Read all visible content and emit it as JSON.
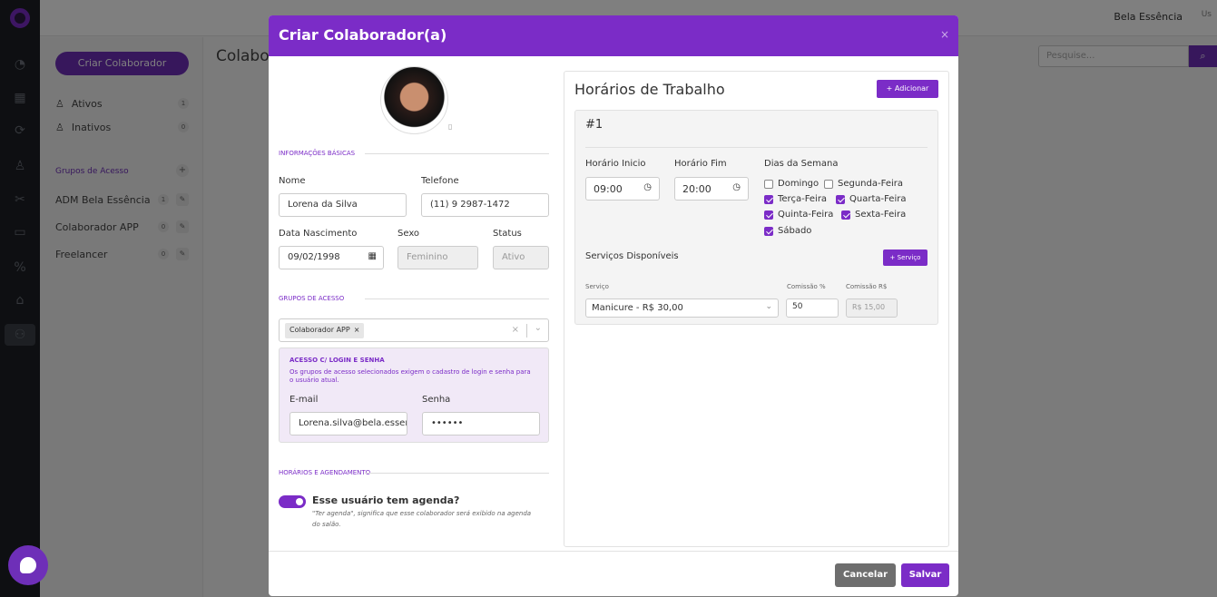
{
  "app": {
    "brand": "Bela Essência",
    "avatar_alt": "Us"
  },
  "rail": {
    "icons": [
      "logo-icon",
      "clock-icon",
      "calendar-icon",
      "sync-icon",
      "user-icon",
      "scissors-icon",
      "box-icon",
      "percent-icon",
      "inbox-icon",
      "team-icon"
    ]
  },
  "left": {
    "create_button": "Criar Colaborador",
    "filters": [
      {
        "label": "Ativos",
        "count": "1"
      },
      {
        "label": "Inativos",
        "count": "0"
      }
    ],
    "groups_title": "Grupos de Acesso",
    "groups": [
      {
        "label": "ADM Bela Essência",
        "count": "1"
      },
      {
        "label": "Colaborador APP",
        "count": "0"
      },
      {
        "label": "Freelancer",
        "count": "0"
      }
    ]
  },
  "main": {
    "page_title": "Colabor",
    "search_placeholder": "Pesquise..."
  },
  "modal": {
    "title": "Criar Colaborador(a)",
    "close": "×",
    "basic_section": "Informações Básicas",
    "fields": {
      "nome_label": "Nome",
      "nome": "Lorena da Silva",
      "telefone_label": "Telefone",
      "telefone": "(11) 9 2987-1472",
      "nascimento_label": "Data Nascimento",
      "nascimento": "09/02/1998",
      "sexo_label": "Sexo",
      "sexo": "Feminino",
      "status_label": "Status",
      "status": "Ativo"
    },
    "access_section": "Grupos de Acesso",
    "access_tag": "Colaborador APP",
    "login": {
      "title": "Acesso c/ Login e Senha",
      "desc": "Os grupos de acesso selecionados exigem o cadastro de login e senha para o usuário atual.",
      "email_label": "E-mail",
      "email": "Lorena.silva@bela.essencia",
      "senha_label": "Senha",
      "senha": "••••••"
    },
    "schedule_section": "Horários e Agendamento",
    "agenda_label": "Esse usuário tem agenda?",
    "agenda_hint": "\"Ter agenda\", significa que esse colaborador será exibido na agenda do salão.",
    "hours": {
      "title": "Horários de Trabalho",
      "add_button": "+ Adicionar",
      "card_num": "#1",
      "start_label": "Horário Inicio",
      "start": "09:00",
      "end_label": "Horário Fim",
      "end": "20:00",
      "days_label": "Dias da Semana",
      "days": [
        {
          "label": "Domingo",
          "checked": false
        },
        {
          "label": "Segunda-Feira",
          "checked": false
        },
        {
          "label": "Terça-Feira",
          "checked": true
        },
        {
          "label": "Quarta-Feira",
          "checked": true
        },
        {
          "label": "Quinta-Feira",
          "checked": true
        },
        {
          "label": "Sexta-Feira",
          "checked": true
        },
        {
          "label": "Sábado",
          "checked": true
        }
      ],
      "services_label": "Serviços Disponíveis",
      "service_button": "+ Serviço",
      "col_service": "Serviço",
      "col_pct": "Comissão %",
      "col_rs": "Comissão R$",
      "service_value": "Manicure - R$ 30,00",
      "pct_value": "50",
      "rs_value": "R$ 15,00"
    },
    "cancel": "Cancelar",
    "save": "Salvar"
  }
}
